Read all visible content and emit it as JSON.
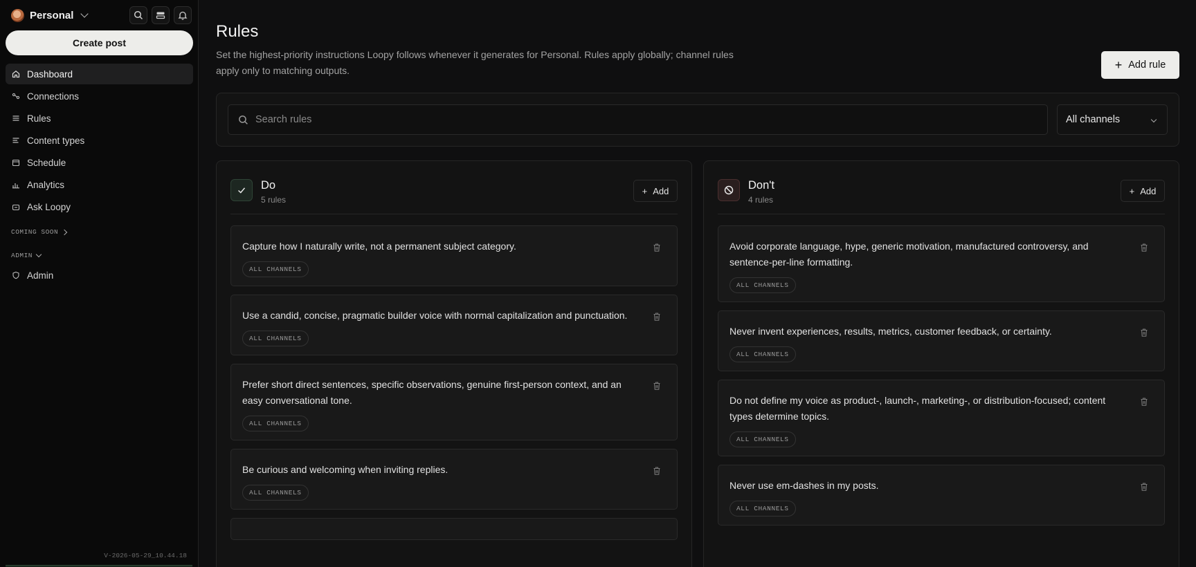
{
  "sidebar": {
    "workspace": "Personal",
    "create_post": "Create post",
    "nav": [
      {
        "label": "Dashboard",
        "icon": "home-icon",
        "active": true
      },
      {
        "label": "Connections",
        "icon": "connections-icon"
      },
      {
        "label": "Rules",
        "icon": "list-icon"
      },
      {
        "label": "Content types",
        "icon": "lines-icon"
      },
      {
        "label": "Schedule",
        "icon": "calendar-icon"
      },
      {
        "label": "Analytics",
        "icon": "bar-chart-icon"
      },
      {
        "label": "Ask Loopy",
        "icon": "bot-icon"
      }
    ],
    "coming_soon": "COMING SOON",
    "admin_section": "ADMIN",
    "admin_item": "Admin",
    "version": "V-2026-05-29_10.44.18"
  },
  "page": {
    "title": "Rules",
    "description": "Set the highest-priority instructions Loopy follows whenever it generates for Personal. Rules apply globally; channel rules apply only to matching outputs.",
    "add_rule": "Add rule"
  },
  "filters": {
    "search_placeholder": "Search rules",
    "channel": "All channels"
  },
  "columns": {
    "do": {
      "title": "Do",
      "count": "5 rules",
      "add": "Add",
      "rules": [
        {
          "text": "Capture how I naturally write, not a permanent subject category.",
          "tag": "ALL CHANNELS"
        },
        {
          "text": "Use a candid, concise, pragmatic builder voice with normal capitalization and punctuation.",
          "tag": "ALL CHANNELS"
        },
        {
          "text": "Prefer short direct sentences, specific observations, genuine first-person context, and an easy conversational tone.",
          "tag": "ALL CHANNELS"
        },
        {
          "text": "Be curious and welcoming when inviting replies.",
          "tag": "ALL CHANNELS"
        }
      ]
    },
    "dont": {
      "title": "Don't",
      "count": "4 rules",
      "add": "Add",
      "rules": [
        {
          "text": "Avoid corporate language, hype, generic motivation, manufactured controversy, and sentence-per-line formatting.",
          "tag": "ALL CHANNELS"
        },
        {
          "text": "Never invent experiences, results, metrics, customer feedback, or certainty.",
          "tag": "ALL CHANNELS"
        },
        {
          "text": "Do not define my voice as product-, launch-, marketing-, or distribution-focused; content types determine topics.",
          "tag": "ALL CHANNELS"
        },
        {
          "text": "Never use em-dashes in my posts.",
          "tag": "ALL CHANNELS"
        }
      ]
    }
  }
}
